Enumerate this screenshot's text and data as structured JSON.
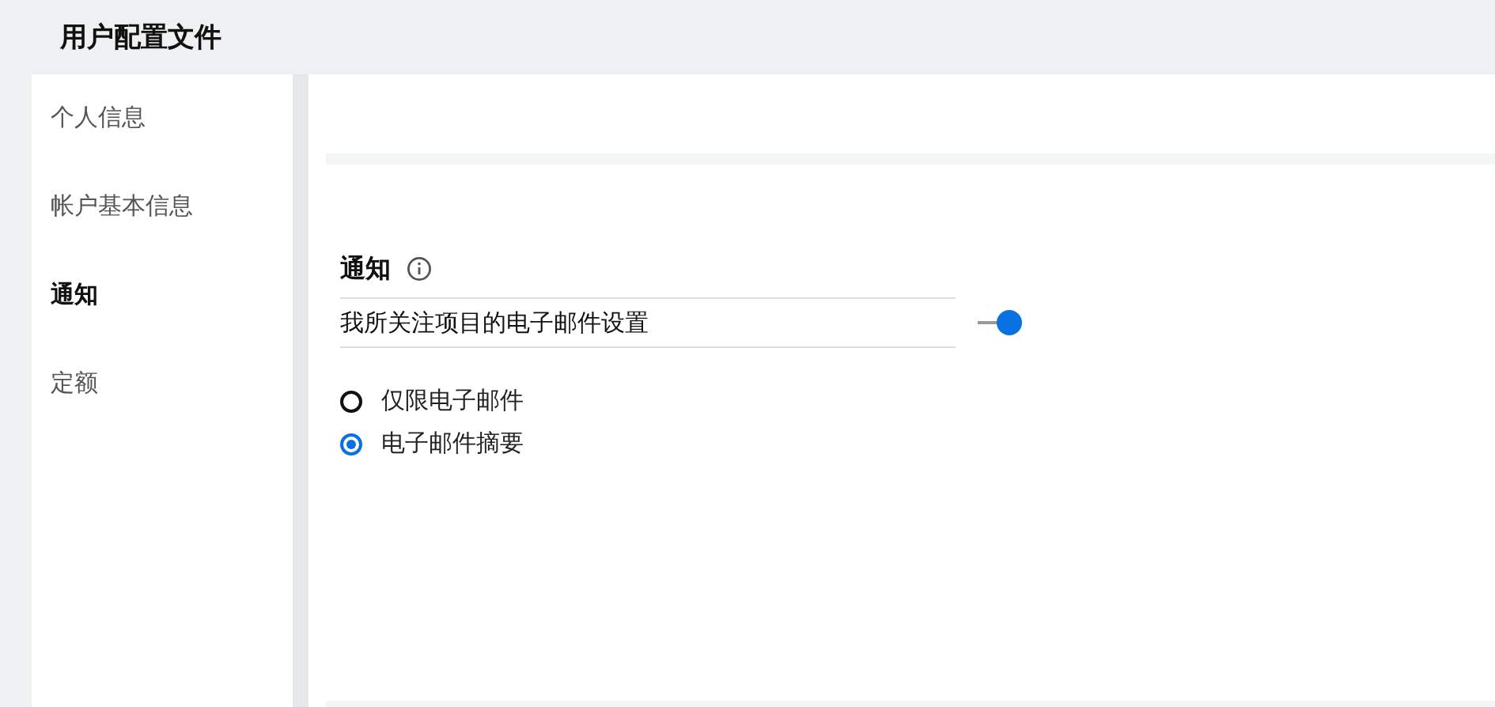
{
  "header": {
    "title": "用户配置文件"
  },
  "sidebar": {
    "items": [
      {
        "label": "个人信息",
        "selected": false
      },
      {
        "label": "帐户基本信息",
        "selected": false
      },
      {
        "label": "通知",
        "selected": true
      },
      {
        "label": "定额",
        "selected": false
      }
    ]
  },
  "section": {
    "title": "通知",
    "setting": {
      "label": "我所关注项目的电子邮件设置",
      "on": true
    },
    "options": [
      {
        "label": "仅限电子邮件",
        "selected": false
      },
      {
        "label": "电子邮件摘要",
        "selected": true
      }
    ]
  }
}
